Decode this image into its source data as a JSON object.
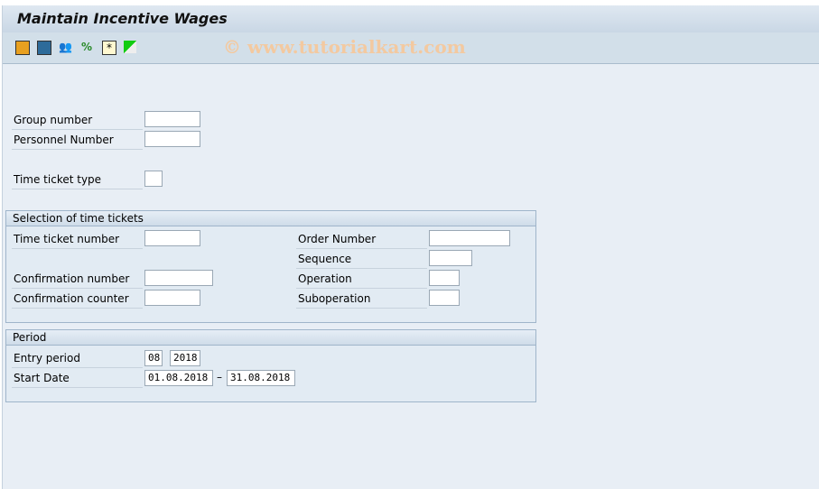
{
  "title": "Maintain Incentive Wages",
  "watermark": "© www.tutorialkart.com",
  "toolbar": [
    "execute-icon",
    "layout-icon",
    "persons-icon",
    "percent-icon",
    "new-entry-icon",
    "variant-icon"
  ],
  "fields": {
    "group": "Group number",
    "pernr": "Personnel Number",
    "ttype": "Time ticket type"
  },
  "selection": {
    "title": "Selection of time tickets",
    "ticket": "Time ticket number",
    "conf": "Confirmation number",
    "counter": "Confirmation counter",
    "order": "Order Number",
    "seq": "Sequence",
    "op": "Operation",
    "subop": "Suboperation"
  },
  "period": {
    "title": "Period",
    "entry": "Entry period",
    "month": "08",
    "year": "2018",
    "start": "Start Date",
    "from": "01.08.2018",
    "dash": "–",
    "to": "31.08.2018"
  }
}
